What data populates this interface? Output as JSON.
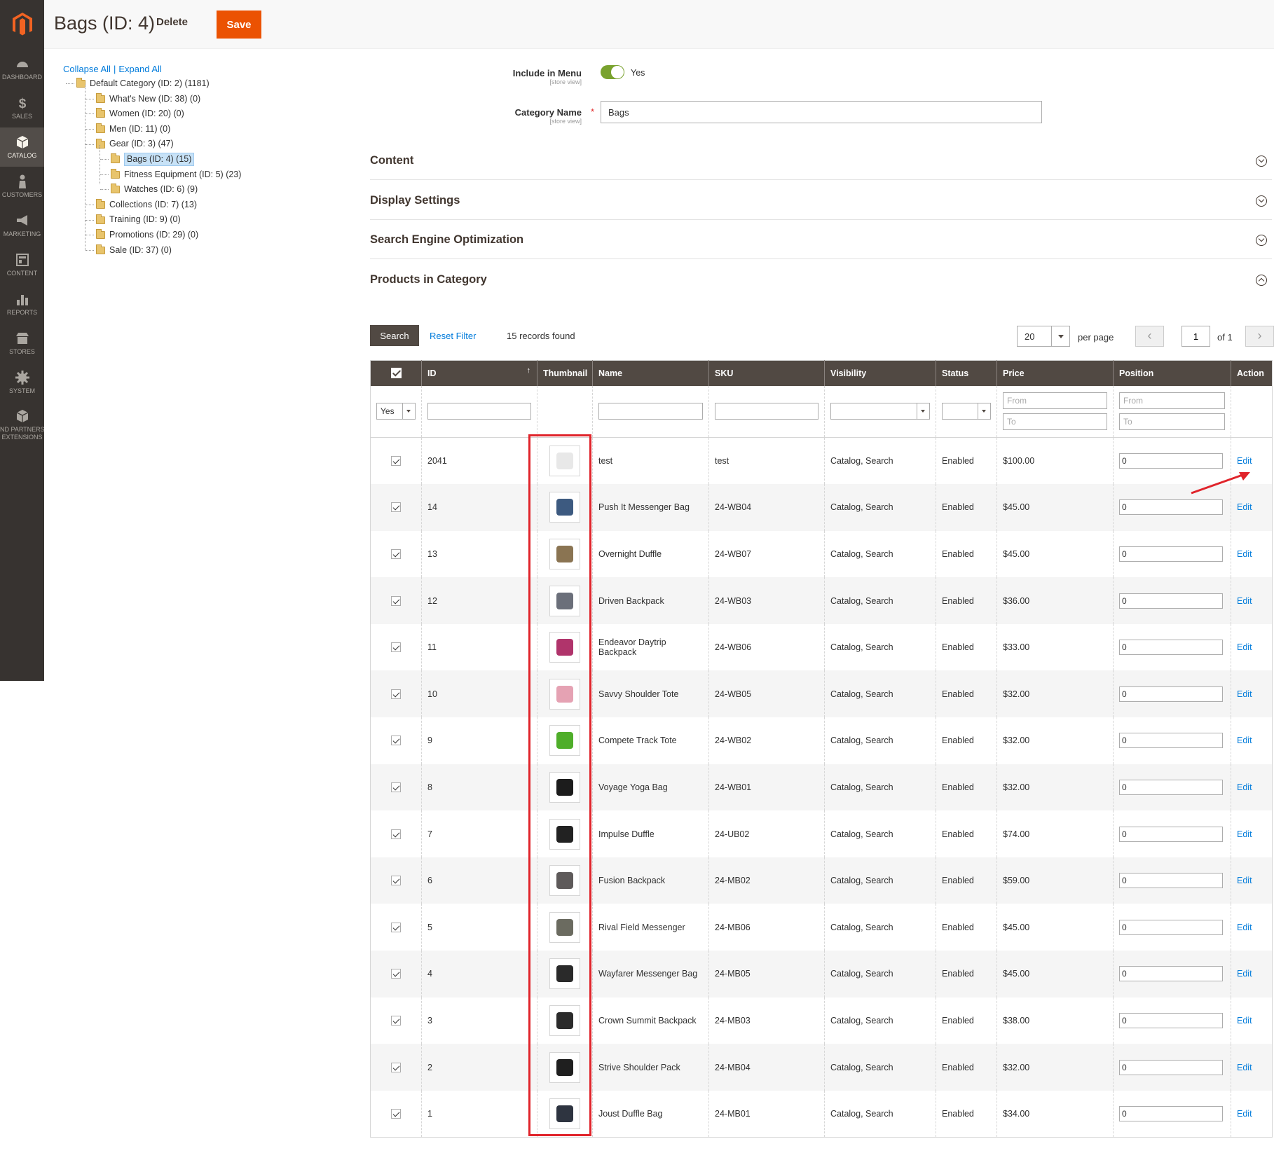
{
  "header": {
    "title": "Bags (ID: 4)",
    "delete_label": "Delete",
    "save_label": "Save"
  },
  "sidebar": {
    "items": [
      {
        "label": "DASHBOARD",
        "icon": "dashboard-icon"
      },
      {
        "label": "SALES",
        "icon": "dollar-icon"
      },
      {
        "label": "CATALOG",
        "icon": "cube-icon",
        "active": true
      },
      {
        "label": "CUSTOMERS",
        "icon": "person-icon"
      },
      {
        "label": "MARKETING",
        "icon": "megaphone-icon"
      },
      {
        "label": "CONTENT",
        "icon": "layout-icon"
      },
      {
        "label": "REPORTS",
        "icon": "bar-chart-icon"
      },
      {
        "label": "STORES",
        "icon": "store-icon"
      },
      {
        "label": "SYSTEM",
        "icon": "gear-icon"
      },
      {
        "label": "ND PARTNERS",
        "label2": "EXTENSIONS",
        "icon": "extensions-icon"
      }
    ]
  },
  "tree": {
    "collapse_all": "Collapse All",
    "separator": "|",
    "expand_all": "Expand All",
    "nodes": [
      {
        "label": "Default Category (ID: 2) (1181)",
        "level": 0
      },
      {
        "label": "What's New (ID: 38) (0)",
        "level": 1
      },
      {
        "label": "Women (ID: 20) (0)",
        "level": 1
      },
      {
        "label": "Men (ID: 11) (0)",
        "level": 1
      },
      {
        "label": "Gear (ID: 3) (47)",
        "level": 1
      },
      {
        "label": "Bags (ID: 4) (15)",
        "level": 2,
        "selected": true
      },
      {
        "label": "Fitness Equipment (ID: 5) (23)",
        "level": 2
      },
      {
        "label": "Watches (ID: 6) (9)",
        "level": 2
      },
      {
        "label": "Collections (ID: 7) (13)",
        "level": 1
      },
      {
        "label": "Training (ID: 9) (0)",
        "level": 1
      },
      {
        "label": "Promotions (ID: 29) (0)",
        "level": 1
      },
      {
        "label": "Sale (ID: 37) (0)",
        "level": 1
      }
    ]
  },
  "form": {
    "include_in_menu_label": "Include in Menu",
    "include_in_menu_scope": "[store view]",
    "include_in_menu_value": "Yes",
    "category_name_label": "Category Name",
    "category_name_scope": "[store view]",
    "required_mark": "*",
    "category_name_value": "Bags"
  },
  "sections": {
    "content": "Content",
    "display_settings": "Display Settings",
    "seo": "Search Engine Optimization",
    "products": "Products in Category"
  },
  "toolbar": {
    "search_label": "Search",
    "reset_filter_label": "Reset Filter",
    "records_found": "15 records found",
    "per_page_value": "20",
    "per_page_label": "per page",
    "prev": "‹",
    "page_value": "1",
    "of_pages": "of 1",
    "next": "›"
  },
  "grid": {
    "columns": [
      "",
      "ID",
      "Thumbnail",
      "Name",
      "SKU",
      "Visibility",
      "Status",
      "Price",
      "Position",
      "Action"
    ],
    "sort_indicator": "↑",
    "filters": {
      "in_category": "Yes",
      "price_from": "From",
      "price_to": "To",
      "position_from": "From",
      "position_to": "To"
    },
    "rows": [
      {
        "id": "2041",
        "name": "test",
        "sku": "test",
        "visibility": "Catalog, Search",
        "status": "Enabled",
        "price": "$100.00",
        "position": "0",
        "action": "Edit",
        "thumb_color": "#e8e8e8"
      },
      {
        "id": "14",
        "name": "Push It Messenger Bag",
        "sku": "24-WB04",
        "visibility": "Catalog, Search",
        "status": "Enabled",
        "price": "$45.00",
        "position": "0",
        "action": "Edit",
        "thumb_color": "#3d5a80"
      },
      {
        "id": "13",
        "name": "Overnight Duffle",
        "sku": "24-WB07",
        "visibility": "Catalog, Search",
        "status": "Enabled",
        "price": "$45.00",
        "position": "0",
        "action": "Edit",
        "thumb_color": "#8a7452"
      },
      {
        "id": "12",
        "name": "Driven Backpack",
        "sku": "24-WB03",
        "visibility": "Catalog, Search",
        "status": "Enabled",
        "price": "$36.00",
        "position": "0",
        "action": "Edit",
        "thumb_color": "#6b6f7a"
      },
      {
        "id": "11",
        "name": "Endeavor Daytrip Backpack",
        "sku": "24-WB06",
        "visibility": "Catalog, Search",
        "status": "Enabled",
        "price": "$33.00",
        "position": "0",
        "action": "Edit",
        "thumb_color": "#b0346b"
      },
      {
        "id": "10",
        "name": "Savvy Shoulder Tote",
        "sku": "24-WB05",
        "visibility": "Catalog, Search",
        "status": "Enabled",
        "price": "$32.00",
        "position": "0",
        "action": "Edit",
        "thumb_color": "#e5a2b3"
      },
      {
        "id": "9",
        "name": "Compete Track Tote",
        "sku": "24-WB02",
        "visibility": "Catalog, Search",
        "status": "Enabled",
        "price": "$32.00",
        "position": "0",
        "action": "Edit",
        "thumb_color": "#4fae2a"
      },
      {
        "id": "8",
        "name": "Voyage Yoga Bag",
        "sku": "24-WB01",
        "visibility": "Catalog, Search",
        "status": "Enabled",
        "price": "$32.00",
        "position": "0",
        "action": "Edit",
        "thumb_color": "#1c1c1c"
      },
      {
        "id": "7",
        "name": "Impulse Duffle",
        "sku": "24-UB02",
        "visibility": "Catalog, Search",
        "status": "Enabled",
        "price": "$74.00",
        "position": "0",
        "action": "Edit",
        "thumb_color": "#222222"
      },
      {
        "id": "6",
        "name": "Fusion Backpack",
        "sku": "24-MB02",
        "visibility": "Catalog, Search",
        "status": "Enabled",
        "price": "$59.00",
        "position": "0",
        "action": "Edit",
        "thumb_color": "#5e5a5a"
      },
      {
        "id": "5",
        "name": "Rival Field Messenger",
        "sku": "24-MB06",
        "visibility": "Catalog, Search",
        "status": "Enabled",
        "price": "$45.00",
        "position": "0",
        "action": "Edit",
        "thumb_color": "#6b6b60"
      },
      {
        "id": "4",
        "name": "Wayfarer Messenger Bag",
        "sku": "24-MB05",
        "visibility": "Catalog, Search",
        "status": "Enabled",
        "price": "$45.00",
        "position": "0",
        "action": "Edit",
        "thumb_color": "#2a2a2a"
      },
      {
        "id": "3",
        "name": "Crown Summit Backpack",
        "sku": "24-MB03",
        "visibility": "Catalog, Search",
        "status": "Enabled",
        "price": "$38.00",
        "position": "0",
        "action": "Edit",
        "thumb_color": "#2b2b2b"
      },
      {
        "id": "2",
        "name": "Strive Shoulder Pack",
        "sku": "24-MB04",
        "visibility": "Catalog, Search",
        "status": "Enabled",
        "price": "$32.00",
        "position": "0",
        "action": "Edit",
        "thumb_color": "#1f1f1f"
      },
      {
        "id": "1",
        "name": "Joust Duffle Bag",
        "sku": "24-MB01",
        "visibility": "Catalog, Search",
        "status": "Enabled",
        "price": "$34.00",
        "position": "0",
        "action": "Edit",
        "thumb_color": "#2e3440"
      }
    ]
  },
  "colors": {
    "brand_orange": "#eb5202",
    "sidebar_bg": "#373330",
    "grid_header": "#514943",
    "link_blue": "#007bdb",
    "highlight_red": "#e0242b",
    "toggle_green": "#79a22e"
  }
}
